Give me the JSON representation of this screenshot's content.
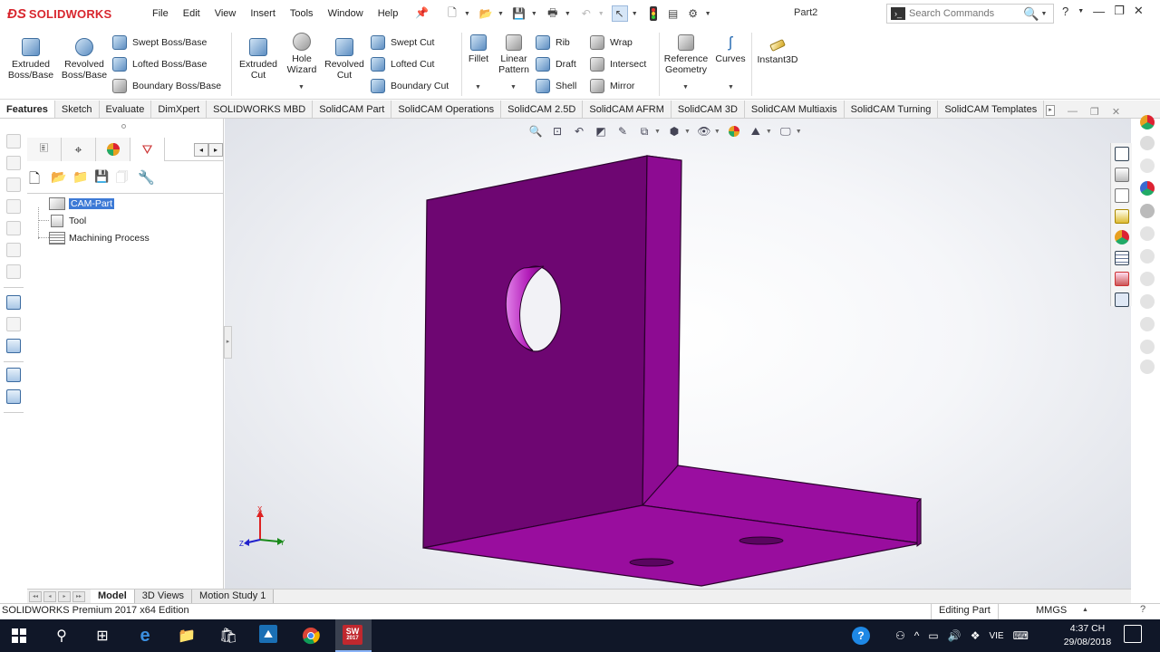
{
  "app": {
    "brand": "SOLIDWORKS",
    "menu": [
      "File",
      "Edit",
      "View",
      "Insert",
      "Tools",
      "Window",
      "Help"
    ],
    "document_title": "Part2",
    "search_placeholder": "Search Commands"
  },
  "ribbon": {
    "extruded_boss": "Extruded\nBoss/Base",
    "revolved_boss": "Revolved\nBoss/Base",
    "swept_boss": "Swept Boss/Base",
    "lofted_boss": "Lofted Boss/Base",
    "boundary_boss": "Boundary Boss/Base",
    "extruded_cut": "Extruded\nCut",
    "hole_wizard": "Hole\nWizard",
    "revolved_cut": "Revolved\nCut",
    "swept_cut": "Swept Cut",
    "lofted_cut": "Lofted Cut",
    "boundary_cut": "Boundary Cut",
    "fillet": "Fillet",
    "linear_pattern": "Linear\nPattern",
    "rib": "Rib",
    "draft": "Draft",
    "shell": "Shell",
    "wrap": "Wrap",
    "intersect": "Intersect",
    "mirror": "Mirror",
    "reference_geometry": "Reference\nGeometry",
    "curves": "Curves",
    "instant3d": "Instant3D"
  },
  "tabs": [
    "Features",
    "Sketch",
    "Evaluate",
    "DimXpert",
    "SOLIDWORKS MBD",
    "SolidCAM Part",
    "SolidCAM Operations",
    "SolidCAM 2.5D",
    "SolidCAM AFRM",
    "SolidCAM 3D",
    "SolidCAM Multiaxis",
    "SolidCAM Turning",
    "SolidCAM Templates"
  ],
  "tree": {
    "root": "CAM-Part",
    "items": [
      "Tool",
      "Machining Process"
    ]
  },
  "triad": {
    "x": "X",
    "y": "Y",
    "z": "Z"
  },
  "bottom_tabs": [
    "Model",
    "3D Views",
    "Motion Study 1"
  ],
  "status": {
    "edition": "SOLIDWORKS Premium 2017 x64 Edition",
    "mode": "Editing Part",
    "units": "MMGS",
    "help": "?"
  },
  "taskbar": {
    "lang": "VIE",
    "time": "4:37 CH",
    "date": "29/08/2018",
    "sw_badge": "2017"
  },
  "colors": {
    "part": "#8a0a8c",
    "brand_red": "#d8262e",
    "taskbar": "#101728"
  }
}
